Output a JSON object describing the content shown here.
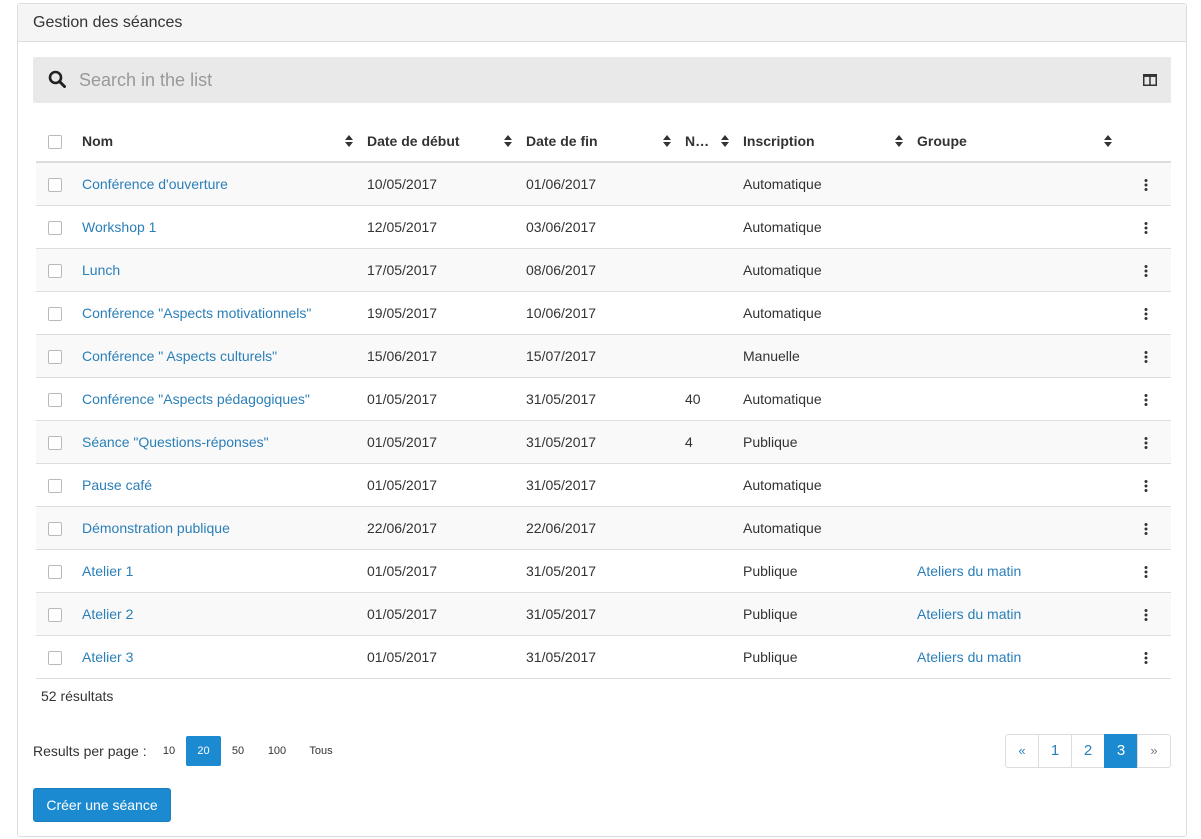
{
  "panel": {
    "title": "Gestion des séances"
  },
  "search": {
    "placeholder": "Search in the list"
  },
  "table": {
    "columns": [
      "Nom",
      "Date de début",
      "Date de fin",
      "N…",
      "Inscription",
      "Groupe"
    ],
    "rows": [
      {
        "nom": "Conférence d'ouverture",
        "debut": "10/05/2017",
        "fin": "01/06/2017",
        "n": "",
        "inscription": "Automatique",
        "groupe": ""
      },
      {
        "nom": "Workshop 1",
        "debut": "12/05/2017",
        "fin": "03/06/2017",
        "n": "",
        "inscription": "Automatique",
        "groupe": ""
      },
      {
        "nom": "Lunch",
        "debut": "17/05/2017",
        "fin": "08/06/2017",
        "n": "",
        "inscription": "Automatique",
        "groupe": ""
      },
      {
        "nom": "Conférence \"Aspects motivationnels\"",
        "debut": "19/05/2017",
        "fin": "10/06/2017",
        "n": "",
        "inscription": "Automatique",
        "groupe": ""
      },
      {
        "nom": "Conférence \" Aspects culturels\"",
        "debut": "15/06/2017",
        "fin": "15/07/2017",
        "n": "",
        "inscription": "Manuelle",
        "groupe": ""
      },
      {
        "nom": "Conférence \"Aspects pédagogiques\"",
        "debut": "01/05/2017",
        "fin": "31/05/2017",
        "n": "40",
        "inscription": "Automatique",
        "groupe": ""
      },
      {
        "nom": "Séance \"Questions-réponses\"",
        "debut": "01/05/2017",
        "fin": "31/05/2017",
        "n": "4",
        "inscription": "Publique",
        "groupe": ""
      },
      {
        "nom": "Pause café",
        "debut": "01/05/2017",
        "fin": "31/05/2017",
        "n": "",
        "inscription": "Automatique",
        "groupe": ""
      },
      {
        "nom": "Démonstration publique",
        "debut": "22/06/2017",
        "fin": "22/06/2017",
        "n": "",
        "inscription": "Automatique",
        "groupe": ""
      },
      {
        "nom": "Atelier 1",
        "debut": "01/05/2017",
        "fin": "31/05/2017",
        "n": "",
        "inscription": "Publique",
        "groupe": "Ateliers du matin"
      },
      {
        "nom": "Atelier 2",
        "debut": "01/05/2017",
        "fin": "31/05/2017",
        "n": "",
        "inscription": "Publique",
        "groupe": "Ateliers du matin"
      },
      {
        "nom": "Atelier 3",
        "debut": "01/05/2017",
        "fin": "31/05/2017",
        "n": "",
        "inscription": "Publique",
        "groupe": "Ateliers du matin"
      }
    ]
  },
  "results": {
    "count_text": "52 résultats"
  },
  "per_page": {
    "label": "Results per page :",
    "options": [
      "10",
      "20",
      "50",
      "100",
      "Tous"
    ],
    "selected": "20"
  },
  "pagination": {
    "prev": "«",
    "pages": [
      "1",
      "2",
      "3"
    ],
    "current": "3",
    "next": "»"
  },
  "create_button": {
    "label": "Créer une séance"
  },
  "colors": {
    "accent": "#1c8ad0",
    "link": "#2a7fb8",
    "header_bg": "#f5f5f5",
    "search_bg": "#e9e9e9"
  },
  "icons": {
    "search": "search-icon",
    "columns": "columns-icon",
    "sort": "sort-icon",
    "row_menu": "kebab-menu-icon"
  }
}
